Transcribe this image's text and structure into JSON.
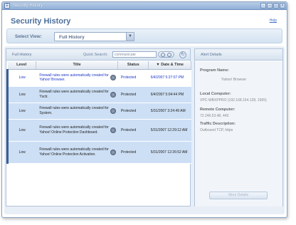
{
  "window": {
    "title": "Security History"
  },
  "header": {
    "title": "Security History",
    "help": "Help"
  },
  "select_view": {
    "label": "Select View:",
    "value": "Full History"
  },
  "left_panel": {
    "title": "Full History",
    "quick_search_label": "Quick Search:",
    "quick_search_value": "communicate",
    "columns": {
      "level": "Level",
      "title": "Title",
      "status": "Status",
      "date": "▼ Date & Time"
    },
    "rows": [
      {
        "level": "Low",
        "title": "Firewall rules were automatically created for Yahoo! Browser.",
        "status": "Protected",
        "date": "6/4/2007 5:27:07 PM"
      },
      {
        "level": "Low",
        "title": "Firewall rules were automatically created for Ysctr.",
        "status": "Protected",
        "date": "6/4/2007 5:04:44 PM"
      },
      {
        "level": "Low",
        "title": "Firewall rules were automatically created for System.",
        "status": "Protected",
        "date": "5/31/2007 3:24:49 AM"
      },
      {
        "level": "Low",
        "title": "Firewall rules were automatically created for Yahoo! Online Protection Dashboard.",
        "status": "Protected",
        "date": "5/31/2007 12:29:12 AM"
      },
      {
        "level": "Low",
        "title": "Firewall rules were automatically created for Yahoo! Online Protection Activation.",
        "status": "Protected",
        "date": "5/31/2007 12:26:52 AM"
      }
    ]
  },
  "right_panel": {
    "title": "Alert Details",
    "program_name_label": "Program Name:",
    "program_name_value": "Yahoo! Browser",
    "local_computer_label": "Local Computer:",
    "local_computer_value": "VPC-WBXPPRO (192.168.154.128, 1565)",
    "remote_computer_label": "Remote Computer:",
    "remote_computer_value": "72.246.53.48, 443",
    "traffic_label": "Traffic Description:",
    "traffic_value": "Outbound TCP, https",
    "more_details": "More Details"
  },
  "colors": {
    "accent": "#4d6f9c",
    "row_alt": "#cddff5",
    "link": "#1a33c9"
  }
}
